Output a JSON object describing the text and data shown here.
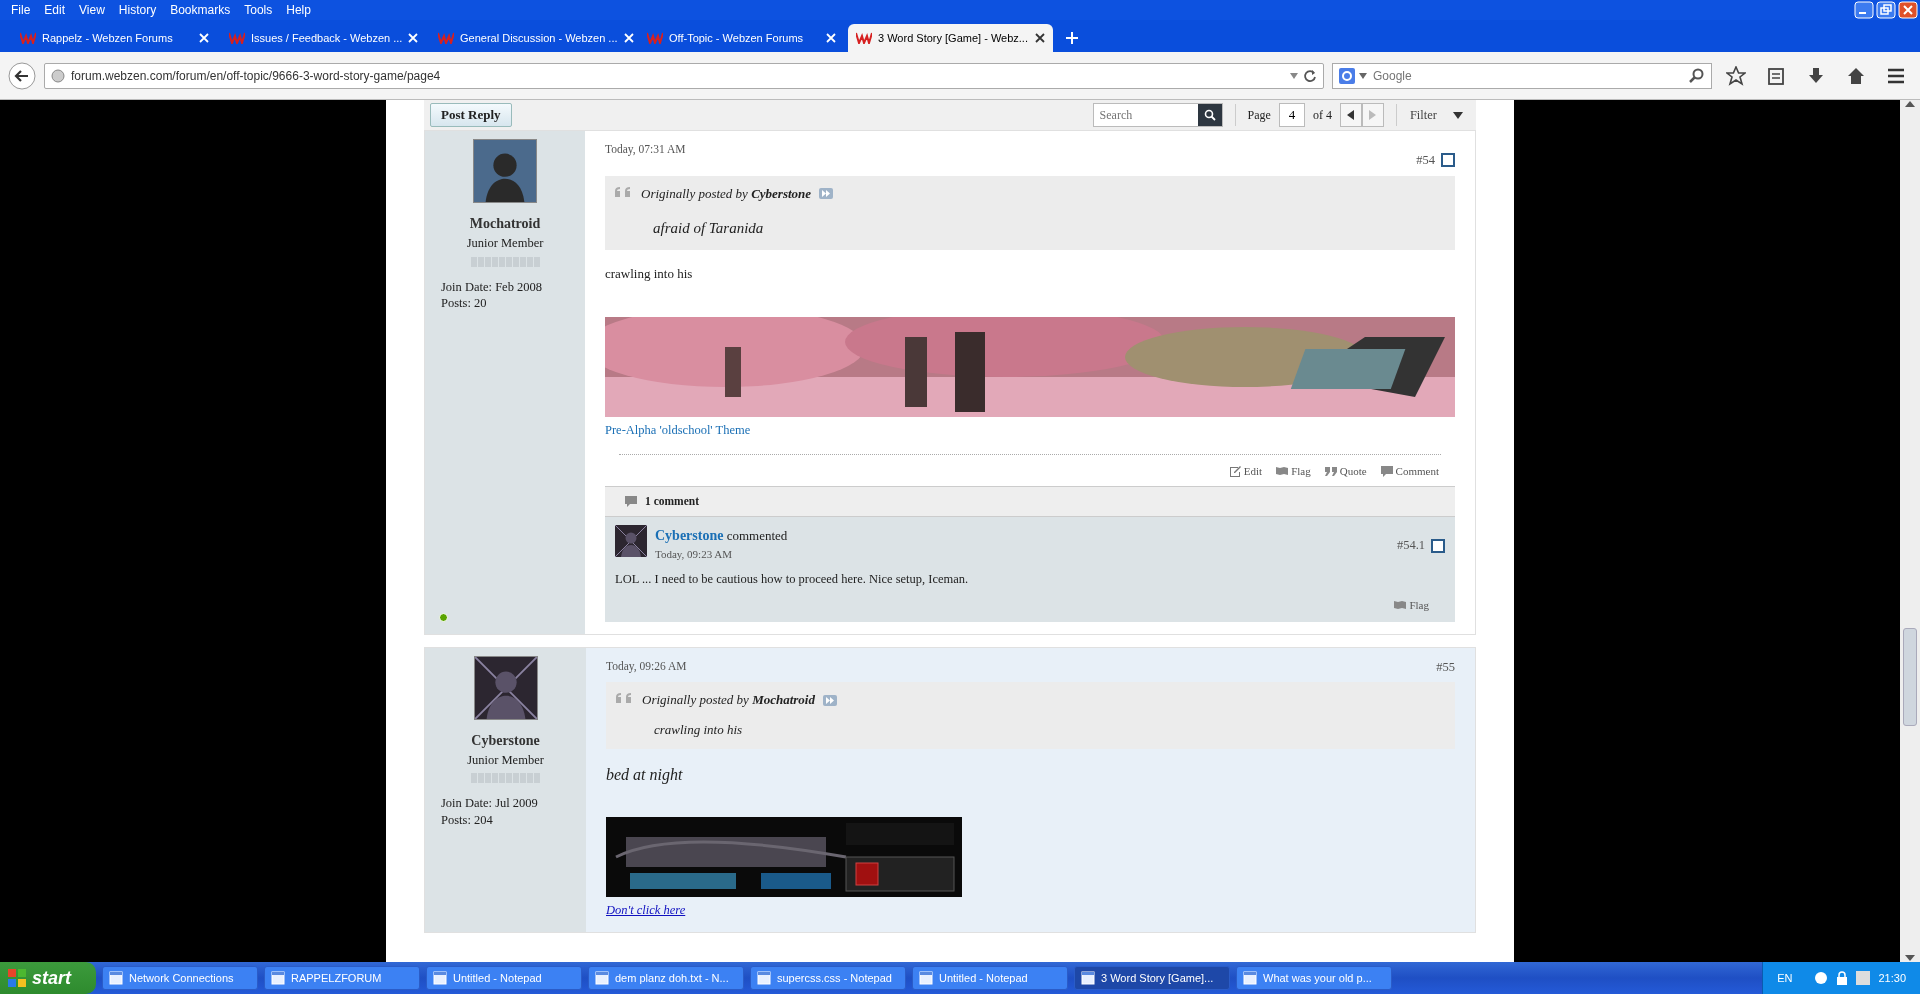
{
  "menu": [
    "File",
    "Edit",
    "View",
    "History",
    "Bookmarks",
    "Tools",
    "Help"
  ],
  "tabs": [
    {
      "label": "Rappelz - Webzen Forums",
      "selected": false
    },
    {
      "label": "Issues / Feedback - Webzen ...",
      "selected": false
    },
    {
      "label": "General Discussion - Webzen ...",
      "selected": false
    },
    {
      "label": "Off-Topic - Webzen Forums",
      "selected": false
    },
    {
      "label": "3 Word Story [Game] - Webz...",
      "selected": true
    }
  ],
  "address": {
    "url": "forum.webzen.com/forum/en/off-topic/9666-3-word-story-game/page4"
  },
  "web_search": {
    "placeholder": "Google"
  },
  "forum_toolbar": {
    "post_reply": "Post Reply",
    "search_placeholder": "Search",
    "page_label": "Page",
    "page_value": "4",
    "page_total": "of 4",
    "filter": "Filter"
  },
  "posts": [
    {
      "author": "Mochatroid",
      "rank": "Junior Member",
      "join_date": "Join Date: Feb 2008",
      "post_count": "Posts: 20",
      "online": true,
      "highlighted": false,
      "date": "Today, 07:31 AM",
      "number": "#54",
      "selected": false,
      "quote": {
        "prefix": "Originally posted by",
        "author": "Cyberstone",
        "text": "afraid of Taranida"
      },
      "body": "crawling into his",
      "body_italic": false,
      "signature": {
        "kind": "landscape",
        "link": "Pre-Alpha 'oldschool' Theme"
      },
      "actions": [
        "Edit",
        "Flag",
        "Quote",
        "Comment"
      ],
      "comments_header": "1 comment",
      "comments": [
        {
          "author": "Cyberstone",
          "verb": "commented",
          "date": "Today, 09:23 AM",
          "number": "#54.1",
          "selected": false,
          "text": "LOL ... I need to be cautious how to proceed here. Nice setup, Iceman.",
          "action": "Flag"
        }
      ]
    },
    {
      "author": "Cyberstone",
      "rank": "Junior Member",
      "join_date": "Join Date: Jul 2009",
      "post_count": "Posts: 204",
      "online": false,
      "highlighted": true,
      "date": "Today, 09:26 AM",
      "number": "#55",
      "quote": {
        "prefix": "Originally posted by",
        "author": "Mochatroid",
        "text": "crawling into his"
      },
      "body": "bed at night",
      "body_italic": true,
      "signature": {
        "kind": "banner",
        "link": "Don't click here"
      }
    }
  ],
  "taskbar": {
    "start": "start",
    "items": [
      {
        "label": "Network Connections",
        "selected": false
      },
      {
        "label": "RAPPELZFORUM",
        "selected": false
      },
      {
        "label": "Untitled - Notepad",
        "selected": false
      },
      {
        "label": "dem planz doh.txt - N...",
        "selected": false
      },
      {
        "label": "supercss.css - Notepad",
        "selected": false
      },
      {
        "label": "Untitled - Notepad",
        "selected": false
      },
      {
        "label": "3 Word Story [Game]...",
        "selected": true
      },
      {
        "label": "What was your old p...",
        "selected": false
      }
    ],
    "language": "EN",
    "clock": "21:30"
  }
}
